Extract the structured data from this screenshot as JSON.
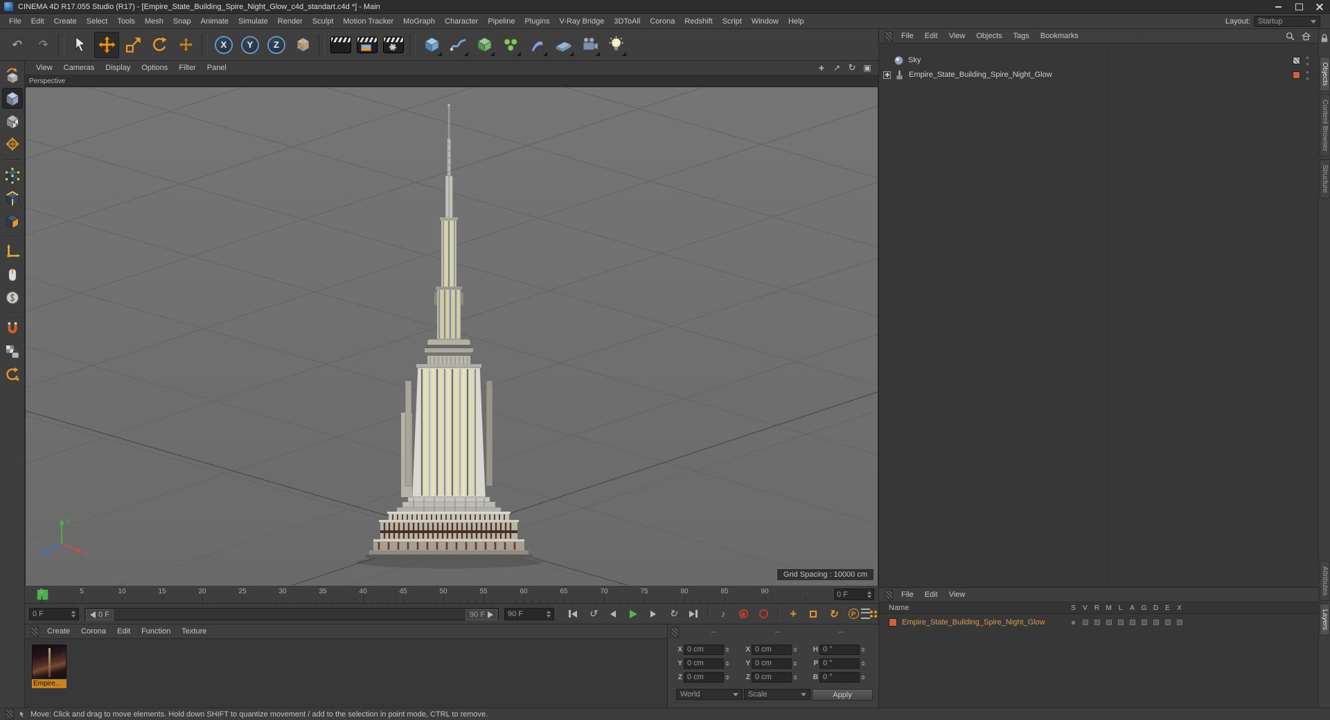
{
  "window": {
    "title": "CINEMA 4D R17.055 Studio (R17) - [Empire_State_Building_Spire_Night_Glow_c4d_standart.c4d *] - Main"
  },
  "menu_bar": {
    "items": [
      "File",
      "Edit",
      "Create",
      "Select",
      "Tools",
      "Mesh",
      "Snap",
      "Animate",
      "Simulate",
      "Render",
      "Sculpt",
      "Motion Tracker",
      "MoGraph",
      "Character",
      "Pipeline",
      "Plugins",
      "V-Ray Bridge",
      "3DToAll",
      "Corona",
      "Redshift",
      "Script",
      "Window",
      "Help"
    ],
    "layout_label": "Layout:",
    "layout_value": "Startup"
  },
  "toolbar": {
    "axis_locks": [
      "X",
      "Y",
      "Z"
    ]
  },
  "viewport": {
    "menus": [
      "View",
      "Cameras",
      "Display",
      "Options",
      "Filter",
      "Panel"
    ],
    "view_label": "Perspective",
    "grid_spacing_label": "Grid Spacing : 10000 cm",
    "axis_gizmo": {
      "x": "x",
      "y": "Y",
      "z": "z"
    }
  },
  "timeline": {
    "ticks": [
      0,
      5,
      10,
      15,
      20,
      25,
      30,
      35,
      40,
      45,
      50,
      55,
      60,
      65,
      70,
      75,
      80,
      85,
      90
    ],
    "frame_field": "0 F"
  },
  "transport": {
    "current_frame": "0 F",
    "range_start": "0 F",
    "range_end": "90 F",
    "end_frame": "90 F",
    "parameter_label": "P"
  },
  "material_manager": {
    "menus": [
      "Create",
      "Corona",
      "Edit",
      "Function",
      "Texture"
    ],
    "materials": [
      {
        "name": "Empire.."
      }
    ]
  },
  "coordinates": {
    "headers": [
      "--",
      "--",
      "--"
    ],
    "rows": [
      {
        "labels": [
          "X",
          "X",
          "H"
        ],
        "values": [
          "0 cm",
          "0 cm",
          "0 °"
        ]
      },
      {
        "labels": [
          "Y",
          "Y",
          "P"
        ],
        "values": [
          "0 cm",
          "0 cm",
          "0 °"
        ]
      },
      {
        "labels": [
          "Z",
          "Z",
          "B"
        ],
        "values": [
          "0 cm",
          "0 cm",
          "0 °"
        ]
      }
    ],
    "transform_space": "World",
    "size_mode": "Scale",
    "apply_label": "Apply"
  },
  "object_manager": {
    "menus": [
      "File",
      "Edit",
      "View",
      "Objects",
      "Tags",
      "Bookmarks"
    ],
    "objects": [
      {
        "name": "Sky"
      },
      {
        "name": "Empire_State_Building_Spire_Night_Glow"
      }
    ]
  },
  "layer_manager": {
    "menus": [
      "File",
      "Edit",
      "View"
    ],
    "name_header": "Name",
    "columns": [
      "S",
      "V",
      "R",
      "M",
      "L",
      "A",
      "G",
      "D",
      "E",
      "X"
    ],
    "layers": [
      {
        "name": "Empire_State_Building_Spire_Night_Glow",
        "color": "#d2603a"
      }
    ]
  },
  "side_tabs": {
    "top": [
      "Objects",
      "Content Browser",
      "Structure"
    ],
    "bottom": [
      "Attributes",
      "Layers"
    ]
  },
  "status_bar": {
    "text": "Move: Click and drag to move elements. Hold down SHIFT to quantize movement / add to the selection in point mode, CTRL to remove."
  },
  "colors": {
    "accent_orange": "#e8962a",
    "layer_chip": "#d2603a",
    "viewport_bg": "#6f6f6f",
    "play_green": "#4db84d",
    "record_red": "#c0392b"
  }
}
